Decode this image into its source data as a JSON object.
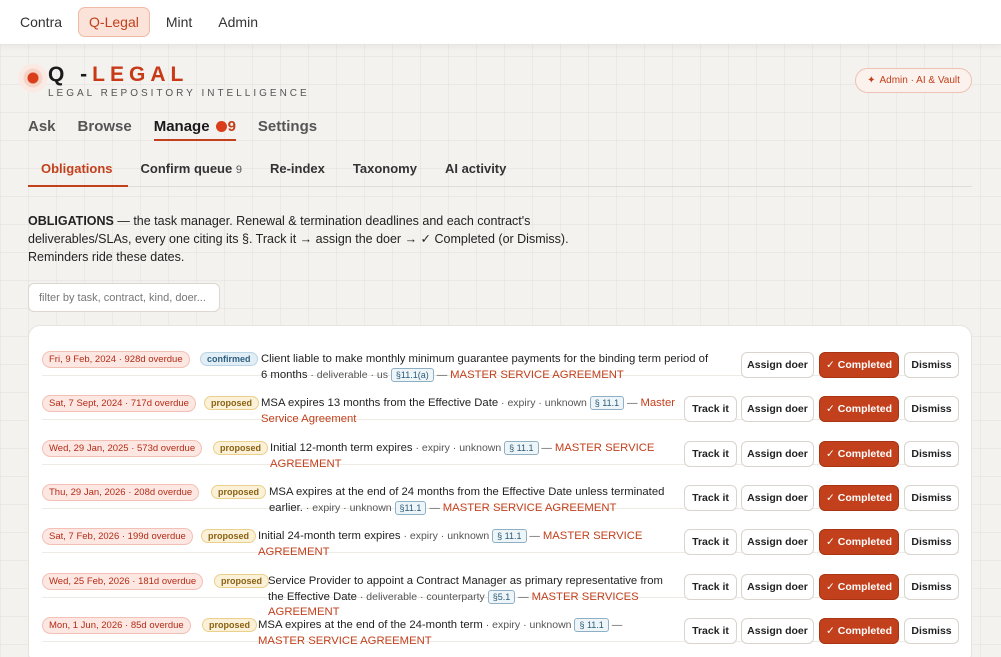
{
  "app_tabs": [
    "Contra",
    "Q-Legal",
    "Mint",
    "Admin"
  ],
  "brand": {
    "title_prefix": "Q -",
    "title_accent": "LEGAL",
    "subtitle": "LEGAL REPOSITORY INTELLIGENCE"
  },
  "admin_pill": "Admin · AI & Vault",
  "main_nav": {
    "ask": "Ask",
    "browse": "Browse",
    "manage": "Manage",
    "manage_count": "9",
    "settings": "Settings"
  },
  "sub_nav": {
    "obligations": "Obligations",
    "confirm_queue": "Confirm queue",
    "confirm_count": "9",
    "reindex": "Re-index",
    "taxonomy": "Taxonomy",
    "ai_activity": "AI activity"
  },
  "intro": {
    "lead": "OBLIGATIONS",
    "body": " — the task manager. Renewal & termination deadlines and each contract's deliverables/SLAs, every one citing its §. Track it → assign the doer → ✓ Completed (or Dismiss). Reminders ride these dates."
  },
  "filter_placeholder": "filter by task, contract, kind, doer...",
  "buttons": {
    "track": "Track it",
    "assign": "Assign doer",
    "completed": "✓ Completed",
    "dismiss": "Dismiss"
  },
  "obligations": [
    {
      "date": "Fri, 9 Feb, 2024 · 928d overdue",
      "status": "confirmed",
      "text": "Client liable to make monthly minimum guarantee payments for the binding term period of 6 months",
      "meta": " · deliverable · us ",
      "section": "§11.1(a)",
      "contract": "MASTER SERVICE AGREEMENT",
      "track": false
    },
    {
      "date": "Sat, 7 Sept, 2024 · 717d overdue",
      "status": "proposed",
      "text": "MSA expires 13 months from the Effective Date",
      "meta": " · expiry · unknown ",
      "section": "§ 11.1",
      "contract": "Master Service Agreement",
      "track": true
    },
    {
      "date": "Wed, 29 Jan, 2025 · 573d overdue",
      "status": "proposed",
      "text": "Initial 12-month term expires",
      "meta": " · expiry · unknown ",
      "section": "§ 11.1",
      "contract": "MASTER SERVICE AGREEMENT",
      "track": true
    },
    {
      "date": "Thu, 29 Jan, 2026 · 208d overdue",
      "status": "proposed",
      "text": "MSA expires at the end of 24 months from the Effective Date unless terminated earlier.",
      "meta": " · expiry · unknown ",
      "section": "§11.1",
      "contract": "MASTER SERVICE AGREEMENT",
      "track": true
    },
    {
      "date": "Sat, 7 Feb, 2026 · 199d overdue",
      "status": "proposed",
      "text": "Initial 24-month term expires",
      "meta": " · expiry · unknown ",
      "section": "§ 11.1",
      "contract": "MASTER SERVICE AGREEMENT",
      "track": true
    },
    {
      "date": "Wed, 25 Feb, 2026 · 181d overdue",
      "status": "proposed",
      "text": "Service Provider to appoint a Contract Manager as primary representative from the Effective Date",
      "meta": " · deliverable · counterparty ",
      "section": "§5.1",
      "contract": "MASTER SERVICES AGREEMENT",
      "track": true
    },
    {
      "date": "Mon, 1 Jun, 2026 · 85d overdue",
      "status": "proposed",
      "text": "MSA expires at the end of the 24-month term",
      "meta": " · expiry · unknown ",
      "section": "§ 11.1",
      "contract": "MASTER SERVICE AGREEMENT",
      "track": true
    }
  ]
}
